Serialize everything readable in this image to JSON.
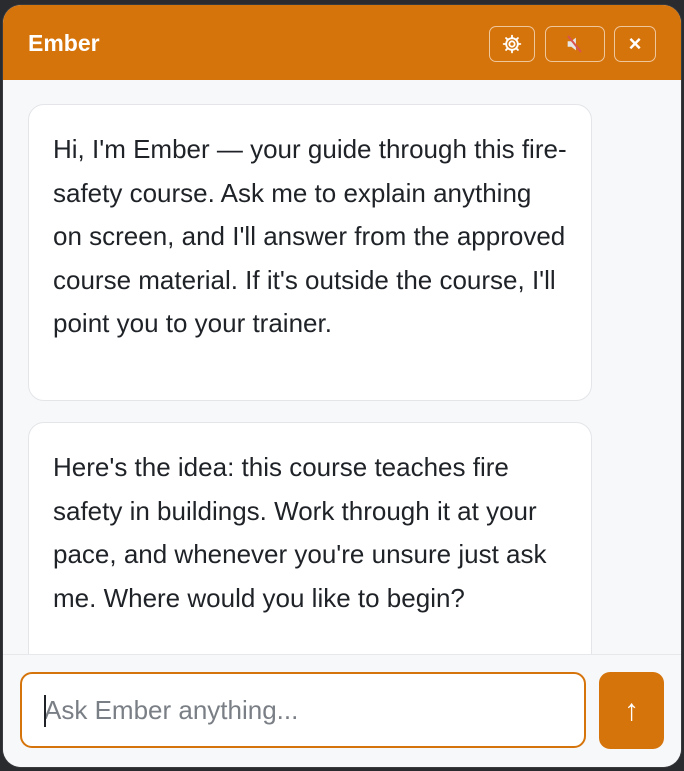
{
  "header": {
    "title": "Ember",
    "settings_icon": "gear-icon",
    "mute_icon": "speaker-muted-icon",
    "close_label": "×"
  },
  "messages": [
    {
      "role": "assistant",
      "text": "Hi, I'm Ember — your guide through this fire-safety course. Ask me to explain anything on screen, and I'll answer from the approved course material. If it's outside the course, I'll point you to your trainer."
    },
    {
      "role": "assistant",
      "text": "Here's the idea: this course teaches fire safety in buildings. Work through it at your pace, and whenever you're unsure just ask me. Where would you like to begin?"
    }
  ],
  "composer": {
    "placeholder": "Ask Ember anything...",
    "value": "",
    "send_label": "↑"
  },
  "colors": {
    "accent": "#d6740c",
    "background": "#f7f8fa",
    "bubble": "#ffffff"
  }
}
